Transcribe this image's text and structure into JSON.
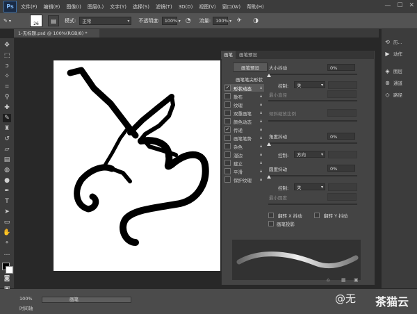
{
  "app": {
    "logo": "Ps"
  },
  "menu": [
    "文件(F)",
    "编辑(E)",
    "图像(I)",
    "图层(L)",
    "文字(Y)",
    "选择(S)",
    "滤镜(T)",
    "3D(D)",
    "视图(V)",
    "窗口(W)",
    "帮助(H)"
  ],
  "window_controls": [
    "—",
    "☐",
    "✕"
  ],
  "options_bar": {
    "brush_size": "26",
    "mode_label": "模式:",
    "mode_value": "正常",
    "opacity_label": "不透明度:",
    "opacity_value": "100%",
    "flow_label": "流量:",
    "flow_value": "100%"
  },
  "document": {
    "tab_title": "1-无标题.psd @ 100%(RGB/8) *"
  },
  "brush_panel": {
    "tabs": [
      "画笔",
      "画笔预设"
    ],
    "preset_button": "画笔预设",
    "tip_heading": "画笔笔尖形状",
    "options": [
      {
        "label": "形状动态",
        "checked": true,
        "selected": true
      },
      {
        "label": "散布",
        "checked": false,
        "selected": false
      },
      {
        "label": "纹理",
        "checked": false,
        "selected": false
      },
      {
        "label": "双重画笔",
        "checked": false,
        "selected": false
      },
      {
        "label": "颜色动态",
        "checked": false,
        "selected": false
      },
      {
        "label": "传递",
        "checked": true,
        "selected": false
      },
      {
        "label": "画笔笔势",
        "checked": false,
        "selected": false
      },
      {
        "label": "杂色",
        "checked": false,
        "selected": false
      },
      {
        "label": "湿边",
        "checked": false,
        "selected": false
      },
      {
        "label": "建立",
        "checked": false,
        "selected": false
      },
      {
        "label": "平滑",
        "checked": false,
        "selected": false
      },
      {
        "label": "保护纹理",
        "checked": false,
        "selected": false
      }
    ],
    "settings": {
      "size_jitter_label": "大小抖动",
      "size_jitter_value": "0%",
      "control_label": "控制:",
      "control1_value": "关",
      "min_diameter_label": "最小直径",
      "tilt_scale_label": "倾斜缩放比例",
      "angle_jitter_label": "角度抖动",
      "angle_jitter_value": "0%",
      "control2_value": "方向",
      "roundness_jitter_label": "圆度抖动",
      "roundness_jitter_value": "0%",
      "control3_value": "关",
      "min_roundness_label": "最小圆度",
      "flip_x_label": "翻转 X 抖动",
      "flip_y_label": "翻转 Y 抖动",
      "brush_projection_label": "画笔投影"
    }
  },
  "right_dock": [
    "历...",
    "动作",
    "图层",
    "通道",
    "路径"
  ],
  "status": {
    "zoom": "100%",
    "brush_label": "画笔",
    "time_label": "时间轴"
  },
  "watermark": {
    "text": "@无",
    "site": "茶猫云"
  },
  "colors": {
    "foreground": "#000000",
    "background": "#ffffff",
    "accent": "#3a6ea8"
  }
}
